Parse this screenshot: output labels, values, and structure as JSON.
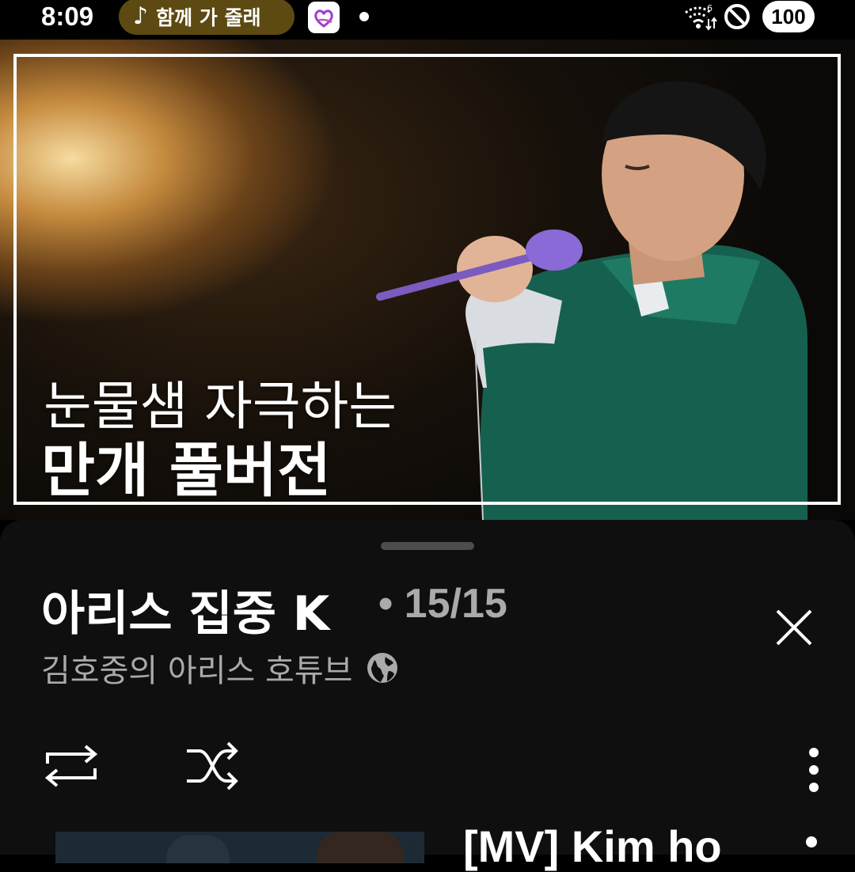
{
  "status_bar": {
    "time": "8:09",
    "now_playing": "함께 가 줄래",
    "battery": "100"
  },
  "thumbnail": {
    "line1": "눈물샘 자극하는",
    "line2": "만개 풀버전"
  },
  "playlist": {
    "title": "아리스 집중 K",
    "position": "• 15/15",
    "channel": "김호중의 아리스 호튜브"
  },
  "next_item": {
    "title": "[MV] Kim ho"
  },
  "icons": [
    "music-note-icon",
    "app-heart-icon",
    "wifi-icon",
    "do-not-disturb-icon",
    "close-icon",
    "globe-icon",
    "repeat-icon",
    "shuffle-icon",
    "more-vert-icon"
  ],
  "colors": {
    "background": "#000000",
    "sheet": "#0f0f0f",
    "pill": "#5c4a12",
    "secondary_text": "#aaaaaa",
    "app_icon_accent": "#9b3fd0"
  }
}
